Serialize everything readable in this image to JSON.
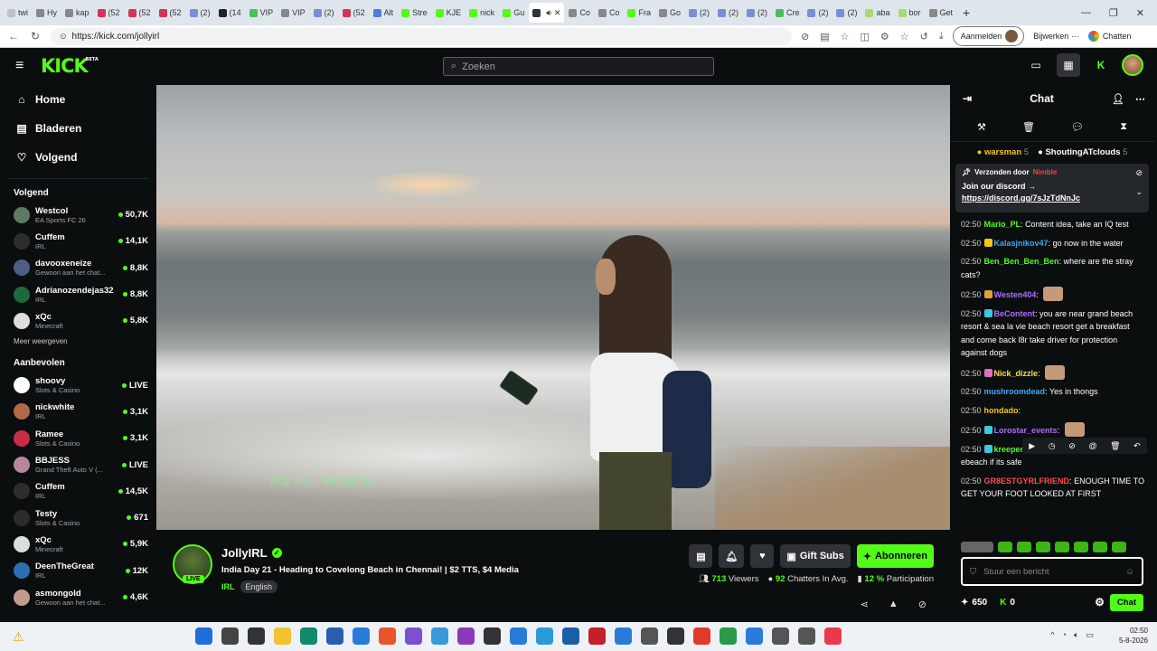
{
  "browser": {
    "tabs": [
      {
        "label": "twi",
        "color": "#c0c0c0"
      },
      {
        "label": "Hy",
        "color": "#888"
      },
      {
        "label": "kap",
        "color": "#888"
      },
      {
        "label": "(52",
        "color": "#d0355a"
      },
      {
        "label": "(52",
        "color": "#d0355a"
      },
      {
        "label": "(52",
        "color": "#d0355a"
      },
      {
        "label": "(2)",
        "color": "#7a8fd1"
      },
      {
        "label": "(14",
        "color": "#222"
      },
      {
        "label": "VIP",
        "color": "#4bbf59"
      },
      {
        "label": "VIP",
        "color": "#888"
      },
      {
        "label": "(2)",
        "color": "#7a8fd1"
      },
      {
        "label": "(52",
        "color": "#d0355a"
      },
      {
        "label": "Alt",
        "color": "#4a7fd1"
      },
      {
        "label": "Stre",
        "color": "#53fc18"
      },
      {
        "label": "KJE",
        "color": "#53fc18"
      },
      {
        "label": "nick",
        "color": "#53fc18"
      },
      {
        "label": "Gu",
        "color": "#53fc18"
      },
      {
        "label": "",
        "color": "#333"
      },
      {
        "label": "Co",
        "color": "#888"
      },
      {
        "label": "Co",
        "color": "#888"
      },
      {
        "label": "Fra",
        "color": "#53fc18"
      },
      {
        "label": "Go",
        "color": "#888"
      },
      {
        "label": "(2)",
        "color": "#7a8fd1"
      },
      {
        "label": "(2)",
        "color": "#7a8fd1"
      },
      {
        "label": "(2)",
        "color": "#7a8fd1"
      },
      {
        "label": "Cre",
        "color": "#4bbf59"
      },
      {
        "label": "(2)",
        "color": "#7a8fd1"
      },
      {
        "label": "(2)",
        "color": "#7a8fd1"
      },
      {
        "label": "aba",
        "color": "#a8d878"
      },
      {
        "label": "bor",
        "color": "#a8d878"
      },
      {
        "label": "Get",
        "color": "#888"
      }
    ],
    "url": "https://kick.com/jollyirl",
    "signin_label": "Aanmelden",
    "update_label": "Bijwerken",
    "chat_label": "Chatten"
  },
  "header": {
    "logo": "KICK",
    "logo_sup": "BETA",
    "search_placeholder": "Zoeken"
  },
  "sidebar": {
    "nav": [
      {
        "label": "Home",
        "icon": "⌂"
      },
      {
        "label": "Bladeren",
        "icon": "▤"
      },
      {
        "label": "Volgend",
        "icon": "♡"
      }
    ],
    "following_title": "Volgend",
    "following": [
      {
        "name": "Westcol",
        "category": "EA Sports FC 26",
        "viewers": "50,7K",
        "color": "#5f7a64"
      },
      {
        "name": "Cuffem",
        "category": "IRL",
        "viewers": "14,1K",
        "color": "#2d2d2d"
      },
      {
        "name": "davooxeneize",
        "category": "Gewoon aan het chat...",
        "viewers": "8,8K",
        "color": "#4e5d86"
      },
      {
        "name": "Adrianozendejas32",
        "category": "IRL",
        "viewers": "8,8K",
        "color": "#1c6a3a"
      },
      {
        "name": "xQc",
        "category": "Minecraft",
        "viewers": "5,8K",
        "color": "#dddddd"
      }
    ],
    "more_label": "Meer weergeven",
    "recommended_title": "Aanbevolen",
    "recommended": [
      {
        "name": "shoovy",
        "category": "Slots & Casino",
        "viewers": "LIVE",
        "color": "#ffffff"
      },
      {
        "name": "nickwhite",
        "category": "IRL",
        "viewers": "3,1K",
        "color": "#b06a45"
      },
      {
        "name": "Ramee",
        "category": "Slots & Casino",
        "viewers": "3,1K",
        "color": "#c72c48"
      },
      {
        "name": "BBJESS",
        "category": "Grand Theft Auto V (...",
        "viewers": "LIVE",
        "color": "#b7869a"
      },
      {
        "name": "Cuffem",
        "category": "IRL",
        "viewers": "14,5K",
        "color": "#2d2d2d"
      },
      {
        "name": "Testy",
        "category": "Slots & Casino",
        "viewers": "671",
        "color": "#2b2b2b"
      },
      {
        "name": "xQc",
        "category": "Minecraft",
        "viewers": "5,9K",
        "color": "#dddddd"
      },
      {
        "name": "DeenTheGreat",
        "category": "IRL",
        "viewers": "12K",
        "color": "#2c6fb3"
      },
      {
        "name": "asmongold",
        "category": "Gewoon aan het chat...",
        "viewers": "4,6K",
        "color": "#c39a8c"
      }
    ]
  },
  "video": {
    "timestamp_overlay": "Aug 05, 06:20:32"
  },
  "stream": {
    "channel": "JollyIRL",
    "live_badge": "LIVE",
    "title": "India Day 21 - Heading to Covelong Beach in Chennai! | $2 TTS, $4 Media",
    "category": "IRL",
    "language": "English",
    "gift_subs_label": "Gift Subs",
    "subscribe_label": "Abonneren",
    "viewers": "713",
    "viewers_label": "Viewers",
    "chatters": "92",
    "chatters_label": "Chatters In Avg.",
    "participation": "12 %",
    "participation_label": "Participation"
  },
  "chat": {
    "title": "Chat",
    "leaderboard": [
      {
        "name": "warsman",
        "count": "5"
      },
      {
        "name": "ShoutingATclouds",
        "count": "5"
      }
    ],
    "pinned": {
      "sent_by": "Verzonden door",
      "sender": "Nimble",
      "line1": "Join our discord →",
      "link": "https://discord.gg/7sJzTdNnJc"
    },
    "messages": [
      {
        "time": "02:50",
        "user": "Mario_PL",
        "color": "#53fc18",
        "text": "Content idea, take an IQ test",
        "badge": ""
      },
      {
        "time": "02:50",
        "user": "Kalasjnikov47",
        "color": "#3ea8f5",
        "text": "go now in the water",
        "badge": "#f5c518"
      },
      {
        "time": "02:50",
        "user": "Ben_Ben_Ben_Ben",
        "color": "#53fc18",
        "text": "where are the stray cats?",
        "badge": ""
      },
      {
        "time": "02:50",
        "user": "Westen404",
        "color": "#b06cff",
        "text": "",
        "badge": "#e0a040",
        "emote": true
      },
      {
        "time": "02:50",
        "user": "BeContent",
        "color": "#b06cff",
        "text": "you are near grand beach resort & sea la vie beach resort get a breakfast and come back l8r take driver for protection against dogs",
        "badge": "#3ec8e0"
      },
      {
        "time": "02:50",
        "user": "Nick_dizzle",
        "color": "#f5e24b",
        "text": "",
        "badge": "#e070c0",
        "emote": true
      },
      {
        "time": "02:50",
        "user": "mushroomdead",
        "color": "#3ea8f5",
        "text": "Yes in thongs",
        "badge": ""
      },
      {
        "time": "02:50",
        "user": "hondado",
        "color": "#f5c518",
        "text": "",
        "badge": ""
      },
      {
        "time": "02:50",
        "user": "Lorostar_events",
        "color": "#b06cff",
        "text": "",
        "badge": "#3ec8e0",
        "emote": true
      },
      {
        "time": "02:50",
        "user": "kreeper_6",
        "color": "#53fc18",
        "text": "ask someone that knows th ebeach if its safe",
        "badge": "#3ec8e0"
      },
      {
        "time": "02:50",
        "user": "GR8ESTGYRLFRIEND",
        "color": "#ff4b4b",
        "text": "ENOUGH TIME TO GET YOUR FOOT LOOKED AT FIRST",
        "badge": ""
      }
    ],
    "input_placeholder": "Stuur een bericht",
    "points": "650",
    "kick_points": "0",
    "send_label": "Chat"
  },
  "taskbar": {
    "time": "02:50",
    "date": "5-8-2026"
  }
}
